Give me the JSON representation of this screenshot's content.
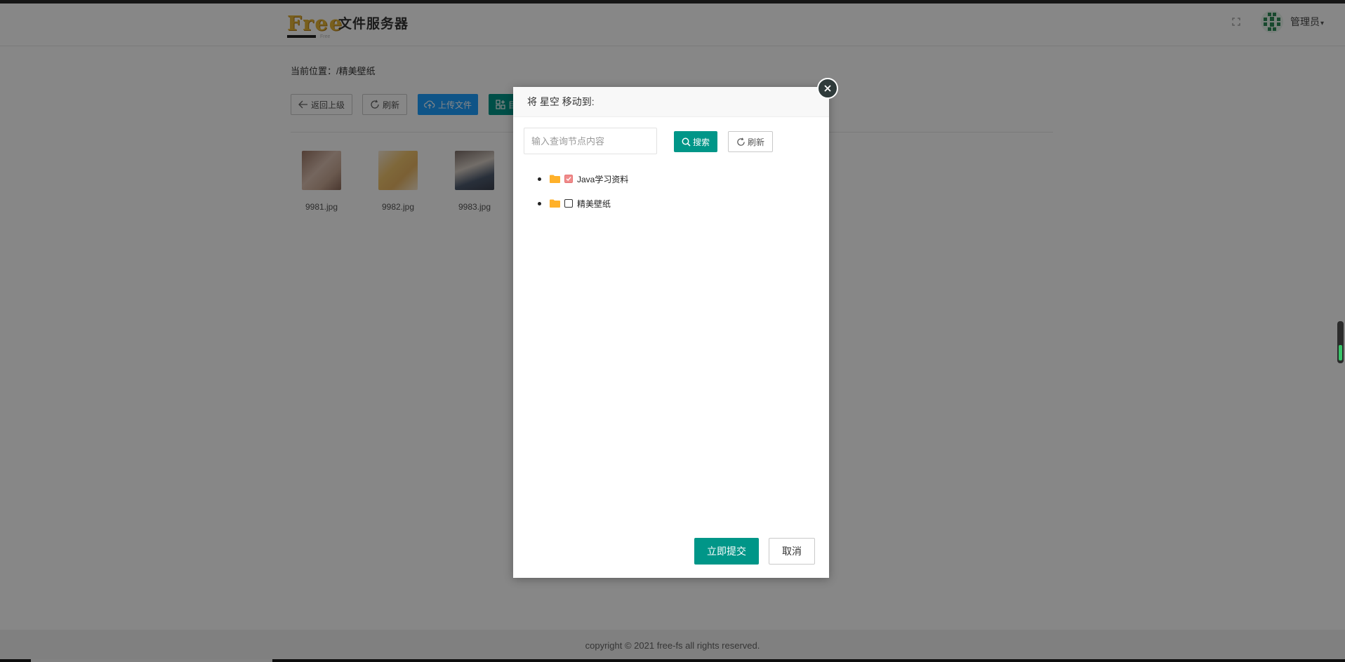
{
  "header": {
    "logo_text": "Free",
    "logo_sub": "Free",
    "title": "文件服务器",
    "user_name": "管理员",
    "caret": "▾"
  },
  "panel": {
    "breadcrumb": "当前位置：/精美壁纸",
    "toolbar": {
      "back_label": "返回上级",
      "refresh_label": "刷新",
      "upload_label": "上传文件",
      "partial_label": "目"
    },
    "files": [
      {
        "name": "9981.jpg"
      },
      {
        "name": "9982.jpg"
      },
      {
        "name": "9983.jpg"
      }
    ]
  },
  "dialog": {
    "title": "将 星空 移动到:",
    "search_placeholder": "输入查询节点内容",
    "search_value": "",
    "search_label": "搜索",
    "refresh_label": "刷新",
    "tree": [
      {
        "label": "Java学习资料",
        "checked": true
      },
      {
        "label": "精美壁纸",
        "checked": false
      }
    ],
    "submit_label": "立即提交",
    "cancel_label": "取消"
  },
  "footer": {
    "copyright": "copyright © 2021 free-fs all rights reserved."
  },
  "colors": {
    "primary_green": "#009688",
    "primary_blue": "#1e9fff",
    "folder": "#ffb12a",
    "checked": "#f08b8b"
  }
}
